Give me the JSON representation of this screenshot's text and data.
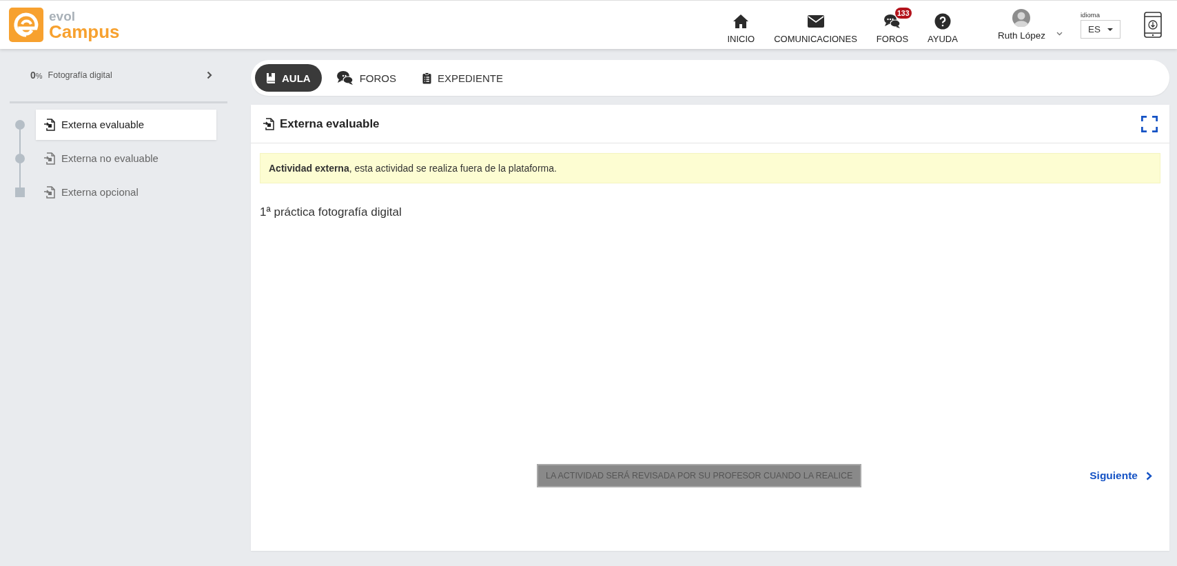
{
  "header": {
    "logo": {
      "top": "evol",
      "bottom": "Campus"
    },
    "nav": [
      {
        "label": "INICIO",
        "kind": "home"
      },
      {
        "label": "COMUNICACIONES",
        "kind": "mail"
      },
      {
        "label": "FOROS",
        "kind": "chat",
        "badge": "133"
      },
      {
        "label": "AYUDA",
        "kind": "help"
      }
    ],
    "user": {
      "name": "Ruth López"
    },
    "language": {
      "label": "idioma",
      "value": "ES"
    }
  },
  "sidebar": {
    "course": {
      "percent": "0",
      "unit": "%",
      "title": "Fotografía digital"
    },
    "items": [
      {
        "label": "Externa evaluable",
        "selected": true,
        "kind": "circle"
      },
      {
        "label": "Externa no evaluable",
        "selected": false,
        "kind": "circle"
      },
      {
        "label": "Externa opcional",
        "selected": false,
        "kind": "square"
      }
    ]
  },
  "tabs": [
    {
      "label": "AULA",
      "kind": "book",
      "selected": true
    },
    {
      "label": "FOROS",
      "kind": "chat",
      "selected": false
    },
    {
      "label": "EXPEDIENTE",
      "kind": "clipboard",
      "selected": false
    }
  ],
  "activity": {
    "title": "Externa evaluable",
    "notice": "**Actividad externa**, esta actividad se realiza fuera de la plataforma.",
    "description": "1ª práctica fotografía digital",
    "status_button": {
      "label": "LA ACTIVIDAD SERÁ REVISADA POR SU PROFESOR CUANDO LA REALICE",
      "disabled": true
    },
    "next_link": "Siguiente"
  }
}
